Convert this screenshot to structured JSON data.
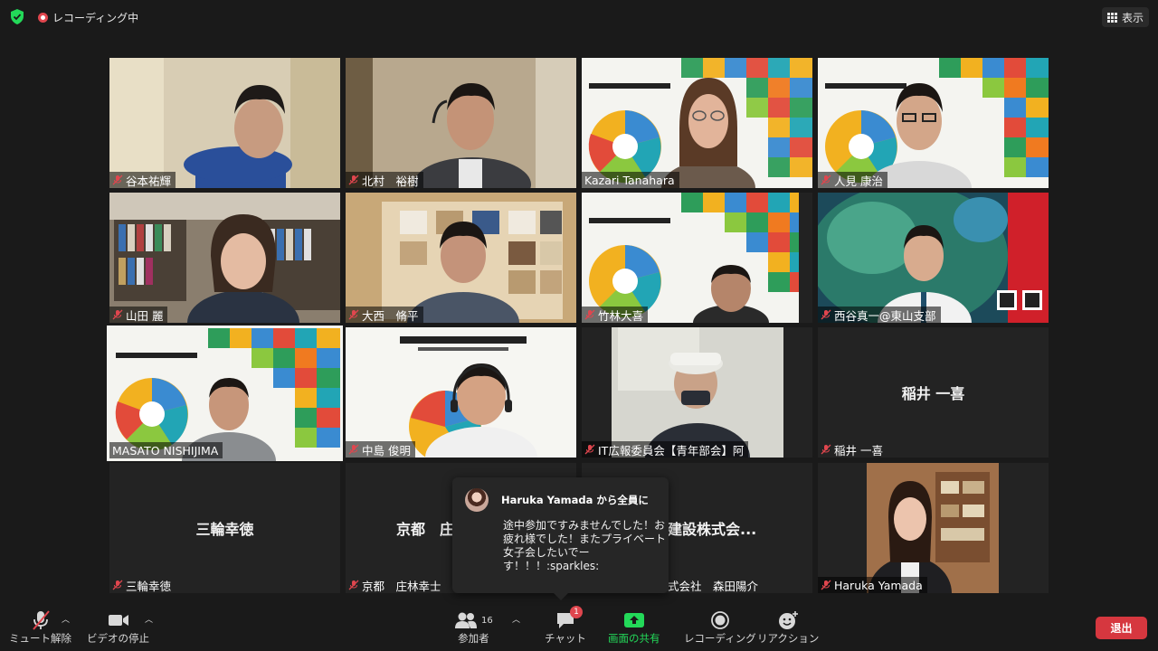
{
  "topbar": {
    "recording_label": "レコーディング中",
    "view_label": "表示"
  },
  "tiles": [
    {
      "name": "谷本祐輝",
      "muted": true
    },
    {
      "name": "北村　裕樹",
      "muted": true
    },
    {
      "name": "Kazari Tanahara",
      "muted": false
    },
    {
      "name": "人見 康治",
      "muted": true
    },
    {
      "name": "山田 麗",
      "muted": true
    },
    {
      "name": "大西　脩平",
      "muted": true
    },
    {
      "name": "竹林大喜",
      "muted": true
    },
    {
      "name": "西谷真一@東山支部",
      "muted": true
    },
    {
      "name": "MASATO NISHIJIMA",
      "muted": false
    },
    {
      "name": "中島 俊明",
      "muted": true
    },
    {
      "name": "IT広報委員会【青年部会】阿",
      "muted": true
    },
    {
      "name": "稲井 一喜",
      "muted": true,
      "center": "稲井 一喜"
    },
    {
      "name": "三輪幸徳",
      "muted": true,
      "center": "三輪幸徳"
    },
    {
      "name": "京都　庄林幸士",
      "muted": true,
      "center": "京都　庄"
    },
    {
      "name": "式会社　森田陽介",
      "muted": false,
      "center": "建設株式会..."
    },
    {
      "name": "Haruka Yamada",
      "muted": true
    }
  ],
  "chat": {
    "header": "Haruka Yamada から全員に",
    "message": "途中参加ですみませんでした！お疲れ様でした！またプライベート女子会したいでーす！！！:sparkles:"
  },
  "toolbar": {
    "mute_label": "ミュート解除",
    "video_label": "ビデオの停止",
    "participants_label": "参加者",
    "participants_count": "16",
    "chat_label": "チャット",
    "chat_badge": "1",
    "share_label": "画面の共有",
    "record_label": "レコーディング",
    "reaction_label": "リアクション",
    "leave_label": "退出"
  },
  "colors": {
    "background": "#1a1a1a",
    "share_green": "#23d959",
    "leave_red": "#d6373f",
    "active_speaker": "#c6d936",
    "muted_red": "#e0464e"
  }
}
